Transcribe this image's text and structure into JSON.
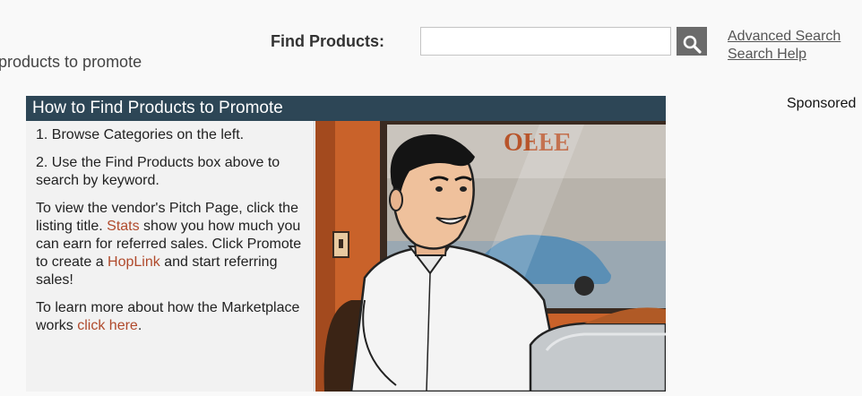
{
  "header": {
    "subtitle": "products to promote",
    "find_label": "Find Products:",
    "search": {
      "value": "",
      "placeholder": ""
    },
    "search_button_icon": "search-icon",
    "advanced_search": "Advanced Search",
    "search_help": "Search Help"
  },
  "sponsored": "Sponsored",
  "panel": {
    "title": "How to Find Products to Promote",
    "step1": "1. Browse Categories on the left.",
    "step2": "2. Use the Find Products box above to search by keyword.",
    "para3": {
      "t1": "To view the vendor's Pitch Page, click the listing title. ",
      "link_stats": "Stats",
      "t2": " show you how much you can earn for referred sales. Click Promote to create a ",
      "link_hoplink": "HopLink",
      "t3": " and start referring sales!"
    },
    "para4": {
      "t1": "To learn more about how the Marketplace works ",
      "link": "click here",
      "t2": "."
    },
    "illustration_sign_text": "OFFE"
  },
  "colors": {
    "header_bg": "#2d4656",
    "link": "#b04a2c",
    "search_button": "#6b6b6b"
  }
}
